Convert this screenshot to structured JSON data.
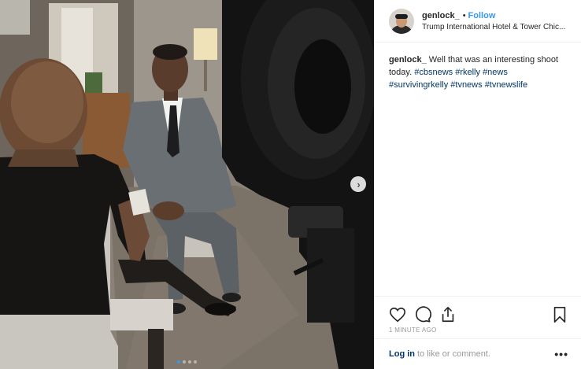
{
  "post": {
    "username": "genlock_",
    "separator": "•",
    "follow_label": "Follow",
    "location": "Trump International Hotel & Tower Chic...",
    "caption_user": "genlock_",
    "caption_text": "Well that was an interesting shoot today.",
    "hashtags": [
      "#cbsnews",
      "#rkelly",
      "#news",
      "#survivingrkelly",
      "#tvnews",
      "#tvnewslife"
    ],
    "timestamp": "1 MINUTE AGO"
  },
  "footer": {
    "login_label": "Log in",
    "rest_text": "to like or comment.",
    "more_label": "•••"
  },
  "carousel": {
    "slide_count": 4,
    "active_index": 0
  },
  "icons": {
    "like": "heart-icon",
    "comment": "comment-icon",
    "share": "share-icon",
    "save": "bookmark-icon",
    "next": "chevron-right-icon"
  },
  "colors": {
    "link_blue": "#3897f0",
    "hashtag_navy": "#003569",
    "muted": "#999999"
  }
}
